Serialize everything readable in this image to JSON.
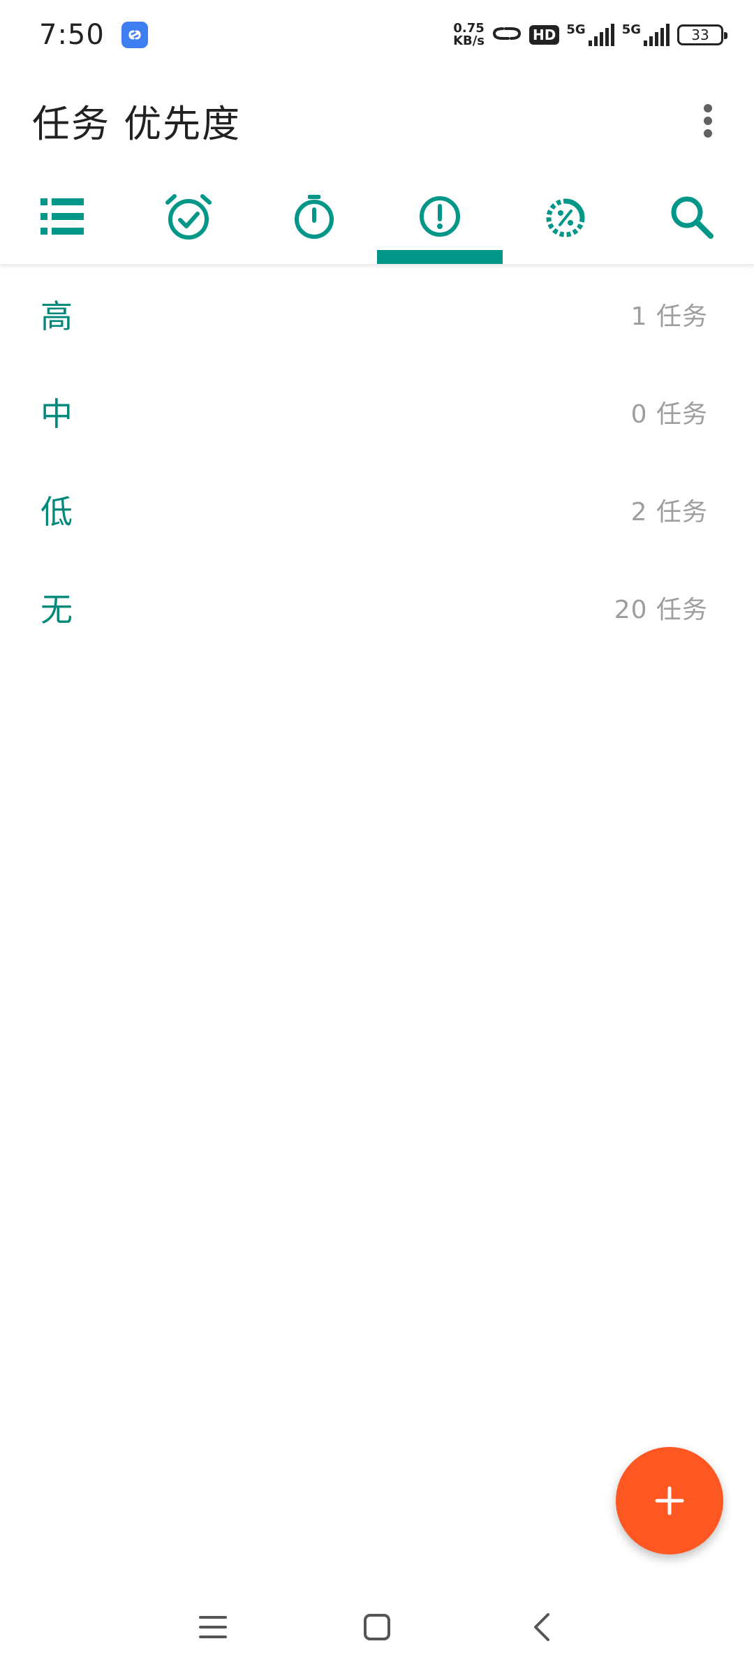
{
  "status_bar": {
    "time": "7:50",
    "speed_value": "0.75",
    "speed_unit": "KB/s",
    "hd_label": "HD",
    "network_1": "5G",
    "network_2": "5G",
    "battery": "33"
  },
  "header": {
    "title": "任务 优先度",
    "menu_icon": "more-vert-icon"
  },
  "tabs": [
    {
      "icon": "list-icon",
      "active": false
    },
    {
      "icon": "alarm-check-icon",
      "active": false
    },
    {
      "icon": "stopwatch-icon",
      "active": false
    },
    {
      "icon": "priority-exclamation-icon",
      "active": true
    },
    {
      "icon": "progress-percent-icon",
      "active": false
    },
    {
      "icon": "search-icon",
      "active": false
    }
  ],
  "priorities": [
    {
      "label": "高",
      "count": "1 任务"
    },
    {
      "label": "中",
      "count": "0 任务"
    },
    {
      "label": "低",
      "count": "2 任务"
    },
    {
      "label": "无",
      "count": "20 任务"
    }
  ],
  "fab": {
    "icon": "plus-icon"
  },
  "nav_bar": {
    "icons": [
      "menu-icon",
      "home-square-icon",
      "back-icon"
    ]
  },
  "colors": {
    "accent": "#009688",
    "label_text": "#00897b",
    "count_text": "#9e9e9e",
    "fab": "#ff5722"
  }
}
